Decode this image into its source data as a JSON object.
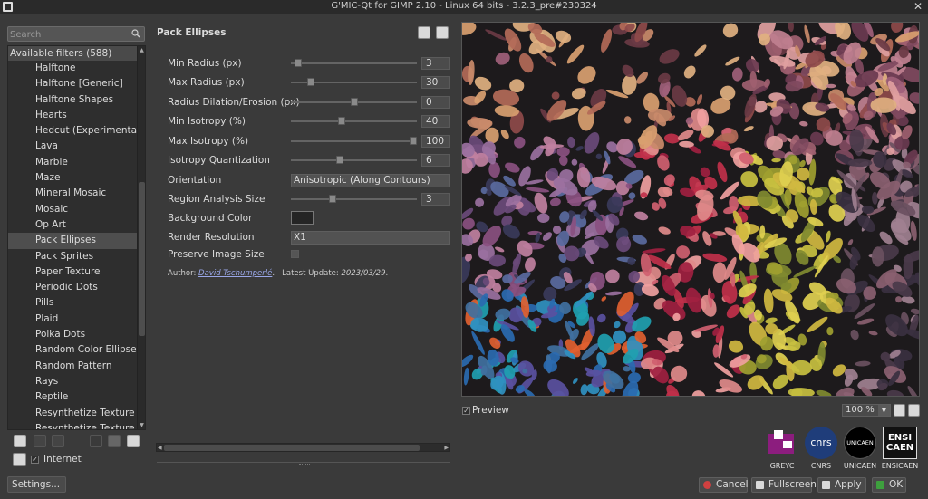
{
  "window": {
    "title": "G'MIC-Qt for GIMP 2.10 - Linux 64 bits - 3.2.3_pre#230324",
    "close_glyph": "✕"
  },
  "search": {
    "placeholder": "Search"
  },
  "filters": {
    "header": "Available filters (588)",
    "items": [
      "Halftone",
      "Halftone [Generic]",
      "Halftone Shapes",
      "Hearts",
      "Hedcut (Experimental)",
      "Lava",
      "Marble",
      "Maze",
      "Mineral Mosaic",
      "Mosaic",
      "Op Art",
      "Pack Ellipses",
      "Pack Sprites",
      "Paper Texture",
      "Periodic Dots",
      "Pills",
      "Plaid",
      "Polka Dots",
      "Random Color Ellipses",
      "Random Pattern",
      "Rays",
      "Reptile",
      "Resynthetize Texture [FFT]",
      "Resynthetize Texture [Patch-Based]"
    ],
    "selected": "Pack Ellipses"
  },
  "internet": {
    "label": "Internet",
    "checked": true
  },
  "settings": {
    "label": "Settings..."
  },
  "filter": {
    "title": "Pack Ellipses",
    "params": [
      {
        "label": "Min Radius (px)",
        "type": "slider",
        "value": "3",
        "fraction": 0.03
      },
      {
        "label": "Max Radius (px)",
        "type": "slider",
        "value": "30",
        "fraction": 0.14
      },
      {
        "label": "Radius Dilation/Erosion (px)",
        "type": "slider",
        "value": "0",
        "fraction": 0.5
      },
      {
        "label": "Min Isotropy (%)",
        "type": "slider",
        "value": "40",
        "fraction": 0.4
      },
      {
        "label": "Max Isotropy (%)",
        "type": "slider",
        "value": "100",
        "fraction": 1.0
      },
      {
        "label": "Isotropy Quantization",
        "type": "slider",
        "value": "6",
        "fraction": 0.38
      },
      {
        "label": "Orientation",
        "type": "combo",
        "value": "Anisotropic (Along Contours)"
      },
      {
        "label": "Region Analysis Size",
        "type": "slider",
        "value": "3",
        "fraction": 0.32
      },
      {
        "label": "Background Color",
        "type": "color",
        "value": "#252525"
      },
      {
        "label": "Render Resolution",
        "type": "combo",
        "value": "X1"
      },
      {
        "label": "Preserve Image Size",
        "type": "checkbox",
        "value": false
      }
    ],
    "author_prefix": "Author:",
    "author_name": "David Tschumperlé",
    "author_suffix": ".",
    "update_prefix": "Latest Update:",
    "update_date": "2023/03/29",
    "update_suffix": "."
  },
  "preview": {
    "label": "Preview",
    "checked": true,
    "zoom": "100 %"
  },
  "logos": [
    {
      "name": "GREYC",
      "color": "#8c1d7e"
    },
    {
      "name": "CNRS",
      "text": "cnrs",
      "color": "#1f3d7a"
    },
    {
      "name": "UNICAEN",
      "text": "UNICAEN",
      "color": "#000000"
    },
    {
      "name": "ENSICAEN",
      "text": "ENSI CAEN",
      "color": "#111111"
    }
  ],
  "buttons": {
    "cancel": "Cancel",
    "fullscreen": "Fullscreen",
    "apply": "Apply",
    "ok": "OK"
  },
  "colors": {
    "accent": "#d04040",
    "background": "#3a3a3a",
    "ok_green": "#3ea03e"
  }
}
